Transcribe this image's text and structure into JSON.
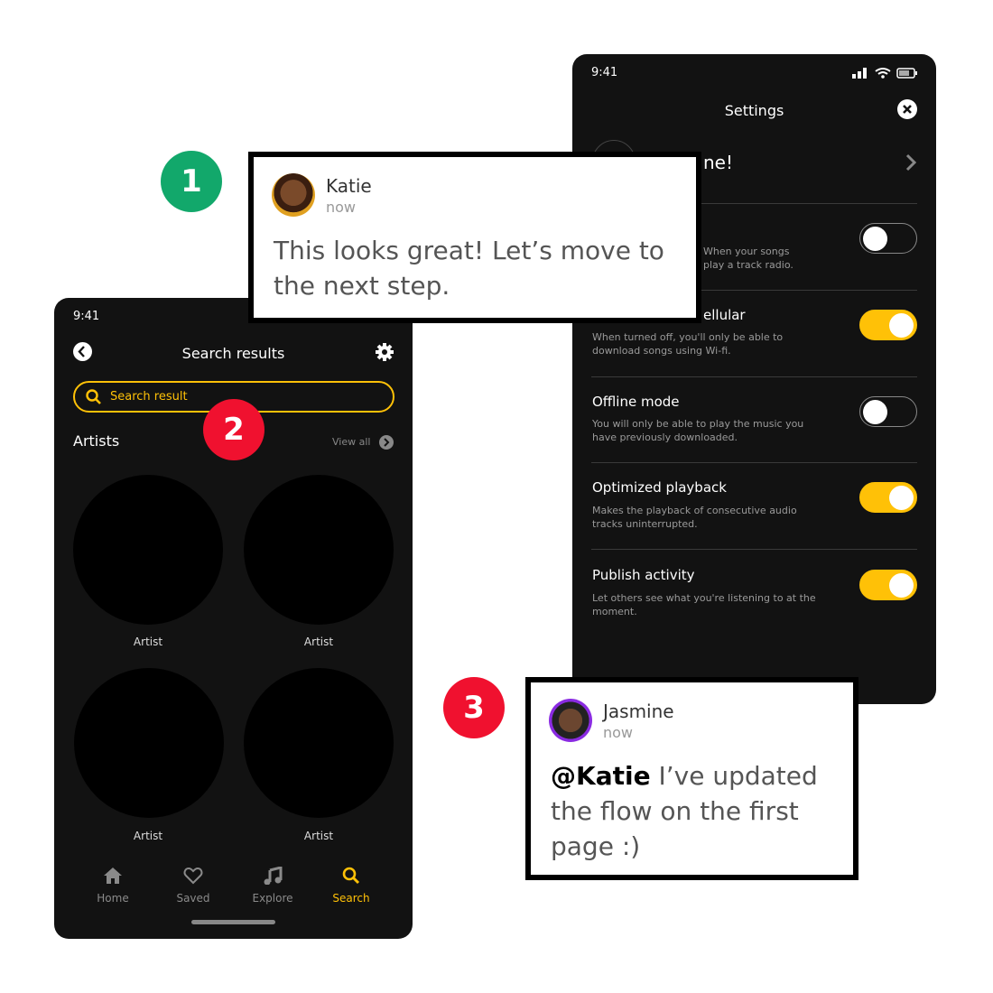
{
  "settings_phone": {
    "time": "9:41",
    "title": "Settings",
    "profile_text": "ne!",
    "rows": [
      {
        "title": "",
        "desc": "When your songs\nplay a track radio.",
        "on": false
      },
      {
        "title": "ellular",
        "desc": "When turned off, you'll only be able to download songs using Wi-fi.",
        "on": true
      },
      {
        "title": "Offline mode",
        "desc": "You will only be able to play the music you have previously downloaded.",
        "on": false
      },
      {
        "title": "Optimized playback",
        "desc": "Makes the playback of consecutive audio tracks uninterrupted.",
        "on": true
      },
      {
        "title": "Publish activity",
        "desc": "Let others see what you're listening to at the moment.",
        "on": true
      }
    ]
  },
  "search_phone": {
    "time": "9:41",
    "title": "Search results",
    "search_value": "Search result",
    "section_title": "Artists",
    "view_all": "View all",
    "artists": [
      "Artist",
      "Artist",
      "Artist",
      "Artist"
    ],
    "nav": [
      {
        "label": "Home",
        "icon": "home-icon"
      },
      {
        "label": "Saved",
        "icon": "heart-icon"
      },
      {
        "label": "Explore",
        "icon": "music-note-icon"
      },
      {
        "label": "Search",
        "icon": "search-icon",
        "active": true
      }
    ]
  },
  "badges": [
    "1",
    "2",
    "3"
  ],
  "comments": [
    {
      "name": "Katie",
      "time": "now",
      "text": "This looks great! Let’s move to the next step."
    },
    {
      "name": "Jasmine",
      "time": "now",
      "mention": "@Katie",
      "text": " I’ve updated the flow on the first page :)"
    }
  ],
  "colors": {
    "accent": "#ffc107",
    "badge_green": "#12a86b",
    "badge_red": "#f0112f",
    "phone_bg": "#121212"
  }
}
